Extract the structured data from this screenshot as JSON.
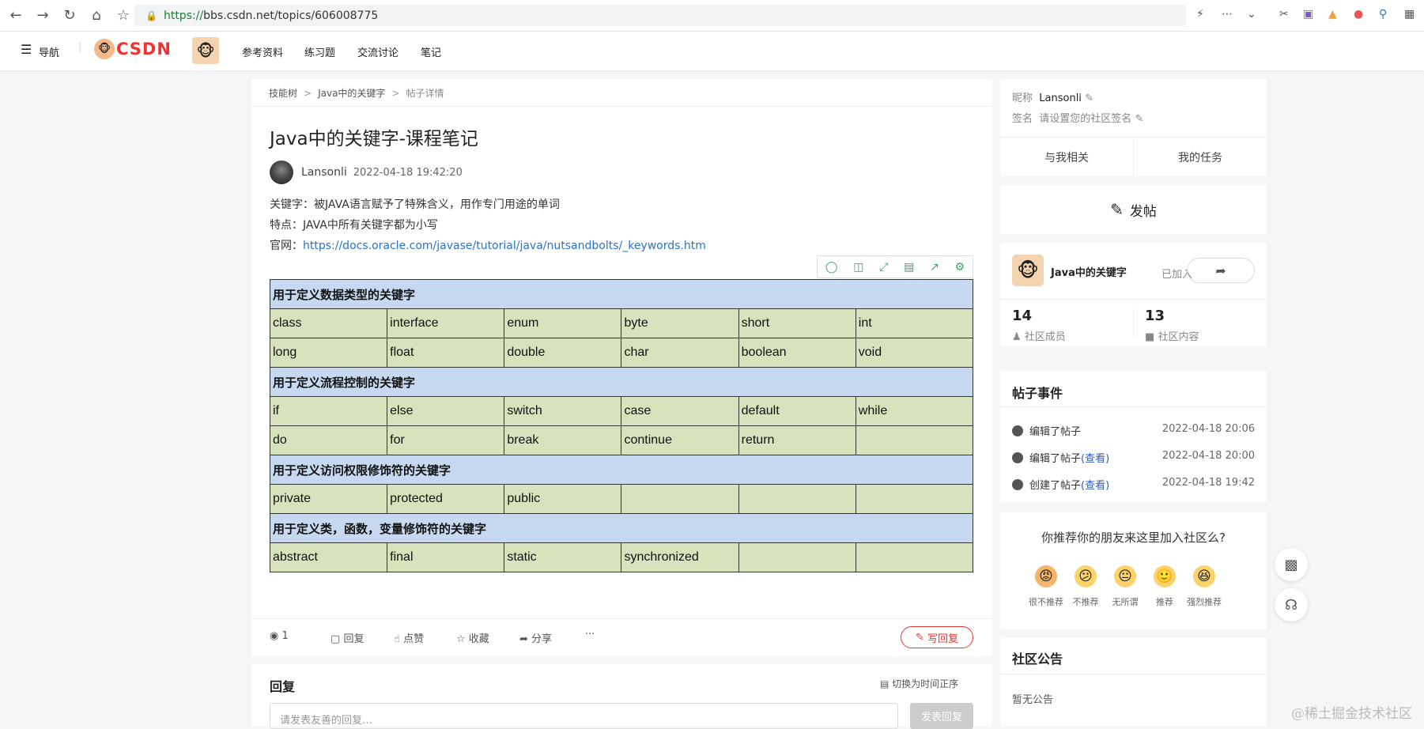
{
  "browser": {
    "url_scheme": "https://",
    "url_rest": "bbs.csdn.net/topics/606008775"
  },
  "topnav": {
    "menu_label": "导航",
    "logo": "CSDN",
    "items": [
      "参考资料",
      "练习题",
      "交流讨论",
      "笔记"
    ]
  },
  "breadcrumb": [
    "技能树",
    "Java中的关键字",
    "帖子详情"
  ],
  "post": {
    "title": "Java中的关键字-课程笔记",
    "author": "Lansonli",
    "date": "2022-04-18 19:42:20",
    "lines": [
      "关键字：被JAVA语言赋予了特殊含义，用作专门用途的单词",
      "特点：JAVA中所有关键字都为小写"
    ],
    "link_prefix": "官网：",
    "link": "https://docs.oracle.com/javase/tutorial/java/nutsandbolts/_keywords.htm"
  },
  "table": {
    "rows": [
      {
        "header": true,
        "text": "用于定义数据类型的关键字"
      },
      {
        "cells": [
          "class",
          "interface",
          "enum",
          "byte",
          "short",
          "int"
        ]
      },
      {
        "cells": [
          "long",
          "float",
          "double",
          "char",
          "boolean",
          "void"
        ]
      },
      {
        "header": true,
        "text": "用于定义流程控制的关键字"
      },
      {
        "cells": [
          "if",
          "else",
          "switch",
          "case",
          "default",
          "while"
        ]
      },
      {
        "cells": [
          "do",
          "for",
          "break",
          "continue",
          "return",
          ""
        ]
      },
      {
        "header": true,
        "text": "用于定义访问权限修饰符的关键字"
      },
      {
        "cells": [
          "private",
          "protected",
          "public",
          "",
          "",
          ""
        ]
      },
      {
        "header": true,
        "text": "用于定义类，函数，变量修饰符的关键字"
      },
      {
        "cells": [
          "abstract",
          "final",
          "static",
          "synchronized",
          "",
          ""
        ]
      }
    ]
  },
  "actions": {
    "views": "1",
    "reply": "回复",
    "like": "点赞",
    "collect": "收藏",
    "share": "分享",
    "more": "···",
    "write_reply": "写回复"
  },
  "reply": {
    "title": "回复",
    "switch_order": "切换为时间正序",
    "placeholder": "请发表友善的回复…",
    "submit": "发表回复"
  },
  "sidebar": {
    "profile": {
      "nick_label": "昵称",
      "nick": "Lansonli",
      "sign_label": "签名",
      "sign": "请设置您的社区签名"
    },
    "tabs": [
      "与我相关",
      "我的任务"
    ],
    "post_button": "发帖",
    "community": {
      "name": "Java中的关键字",
      "joined": "已加入",
      "members": "14",
      "members_label": "社区成员",
      "content": "13",
      "content_label": "社区内容"
    },
    "events": {
      "title": "帖子事件",
      "items": [
        {
          "text": "编辑了帖子",
          "link": "",
          "time": "2022-04-18 20:06"
        },
        {
          "text": "编辑了帖子",
          "link": "(查看)",
          "time": "2022-04-18 20:00"
        },
        {
          "text": "创建了帖子",
          "link": "(查看)",
          "time": "2022-04-18 19:42"
        }
      ]
    },
    "recommend": {
      "question": "你推荐你的朋友来这里加入社区么?",
      "options": [
        "很不推荐",
        "不推荐",
        "无所谓",
        "推荐",
        "强烈推荐"
      ]
    },
    "notice": {
      "title": "社区公告",
      "text": "暂无公告"
    }
  },
  "watermark": "@稀土掘金技术社区"
}
